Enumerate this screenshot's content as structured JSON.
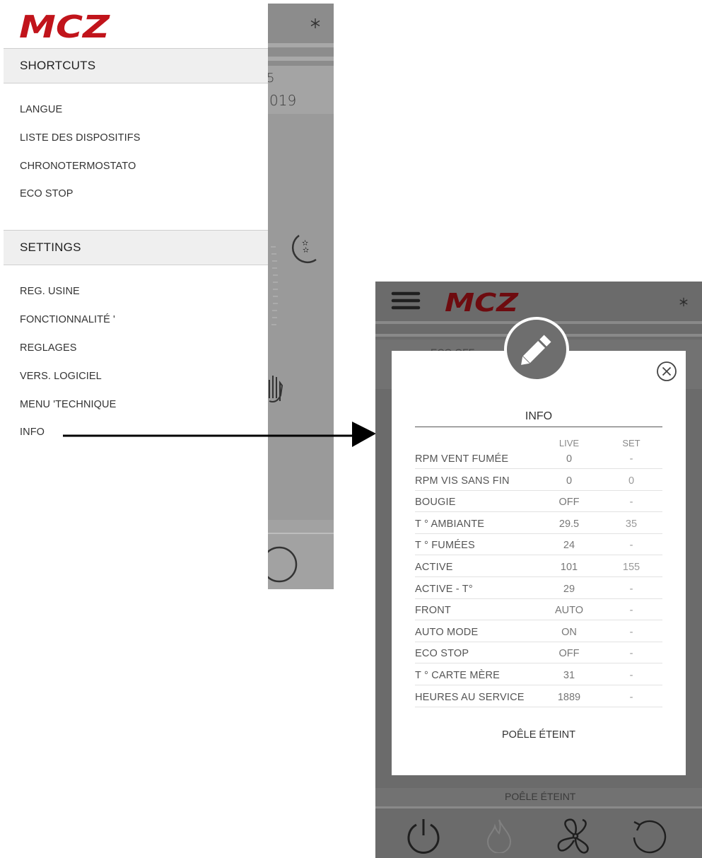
{
  "left_panel": {
    "logo": "MCZ",
    "shortcuts_header": "SHORTCUTS",
    "shortcuts": [
      "LANGUE",
      "LISTE DES DISPOSITIFS",
      "CHRONOTERMOSTATO",
      "ECO STOP"
    ],
    "settings_header": "SETTINGS",
    "settings": [
      "REG. USINE",
      "FONCTIONNALITÉ '",
      "REGLAGES",
      "VERS. LOGICIEL",
      "MENU 'TECHNIQUE",
      "INFO"
    ],
    "background": {
      "date_fragment_top": "5",
      "date_fragment": "019",
      "icons": [
        "snowflake-icon",
        "moon-stars-icon",
        "hand-icon",
        "power-ring-icon"
      ]
    }
  },
  "right_panel": {
    "logo": "MCZ",
    "background_texts": [
      "ECO OFF",
      "POÊLE ÉTEINT"
    ],
    "dialog": {
      "title": "INFO",
      "col_live": "LIVE",
      "col_set": "SET",
      "rows": [
        {
          "label": "RPM VENT FUMÉE",
          "live": "0",
          "set": "-"
        },
        {
          "label": "RPM VIS SANS FIN",
          "live": "0",
          "set": "0"
        },
        {
          "label": "BOUGIE",
          "live": "OFF",
          "set": "-"
        },
        {
          "label": "T ° AMBIANTE",
          "live": "29.5",
          "set": "35"
        },
        {
          "label": "T ° FUMÉES",
          "live": "24",
          "set": "-"
        },
        {
          "label": "ACTIVE",
          "live": "101",
          "set": "155"
        },
        {
          "label": "ACTIVE - T°",
          "live": "29",
          "set": "-"
        },
        {
          "label": "FRONT",
          "live": "AUTO",
          "set": "-"
        },
        {
          "label": "AUTO MODE",
          "live": "ON",
          "set": "-"
        },
        {
          "label": "ECO STOP",
          "live": "OFF",
          "set": "-"
        },
        {
          "label": "T ° CARTE MÈRE",
          "live": "31",
          "set": "-"
        },
        {
          "label": "HEURES AU SERVICE",
          "live": "1889",
          "set": "-"
        }
      ],
      "status": "POÊLE ÉTEINT"
    },
    "bottom_icons": [
      "power-icon",
      "flame-icon",
      "fan-icon",
      "refresh-icon"
    ]
  },
  "colors": {
    "brand_red": "#c1141b",
    "overlay_gray": "#6b6b6b",
    "drawer_header_bg": "#efefef"
  }
}
